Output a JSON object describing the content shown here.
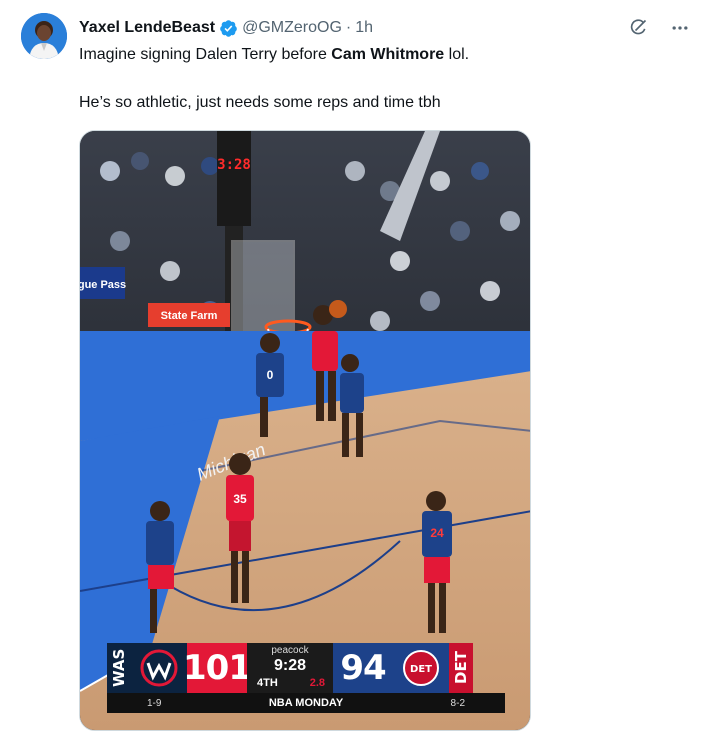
{
  "tweet": {
    "display_name": "Yaxel LendeBeast",
    "handle": "@GMZeroOG",
    "separator": "·",
    "time": "1h",
    "text_part1": "Imagine signing Dalen Terry before ",
    "text_bold": "Cam Whitmore",
    "text_part2": " lol.",
    "text_line2": "He’s so athletic, just needs some reps and time tbh"
  },
  "media": {
    "shot_clock": "3:28",
    "sponsor_sign": "State Farm",
    "ad_sign": "gue Pass",
    "floor_text": "Michigan",
    "jersey_numbers": [
      "0",
      "35",
      "24"
    ]
  },
  "scorebug": {
    "away_abbr": "WAS",
    "away_score": "101",
    "home_score": "94",
    "home_abbr": "DET",
    "network": "peacock",
    "clock": "9:28",
    "period": "4TH",
    "shot_clock": "2.8",
    "away_record": "1-9",
    "home_record": "8-2",
    "branding": "NBA MONDAY",
    "home_logo_text": "DET"
  },
  "colors": {
    "verified": "#1d9bf0",
    "was_red": "#e31837",
    "det_blue": "#1d428a",
    "navy": "#0c2340"
  }
}
